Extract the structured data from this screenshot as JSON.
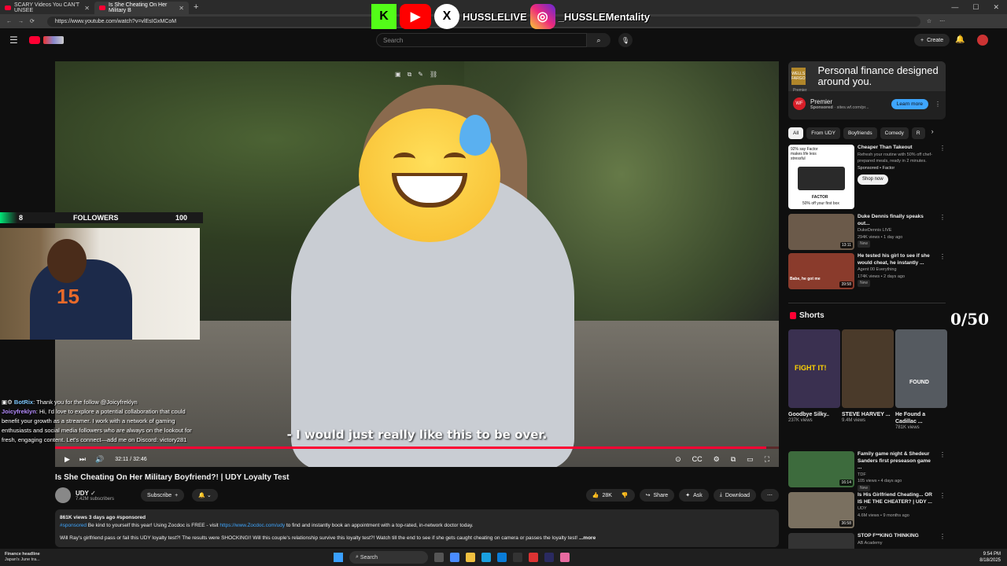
{
  "browser": {
    "tabs": [
      {
        "label": "SCARY Videos You CAN'T UNSEE",
        "active": false
      },
      {
        "label": "Is She Cheating On Her Military B",
        "active": true
      }
    ],
    "url": "https://www.youtube.com/watch?v=vlEsIGxMCoM"
  },
  "overlay": {
    "social_handle_1": "HUSSLELIVE",
    "social_handle_2": "_HUSSLEMentality",
    "followers_count": "8",
    "followers_label": "FOLLOWERS",
    "followers_goal": "100",
    "shorts_counter": "0/50",
    "chat": [
      {
        "user": "BotRix",
        "message": ": Thank you for the follow @Joicyfreklyn"
      },
      {
        "user": "Joicyfreklyn",
        "message": ": Hi, I'd love to explore a potential collaboration that could benefit your growth as a streamer. I work with a network of gaming enthusiasts and social media followers who are always on the lookout for fresh, engaging content. Let's connect—add me on Discord: victory281"
      }
    ]
  },
  "header": {
    "search_placeholder": "Search",
    "create_label": "Create"
  },
  "player": {
    "subtitle": "- I would just really like this to be over.",
    "time": "32:11 / 32:46",
    "progress_fraction": 0.983
  },
  "video": {
    "title": "Is She Cheating On Her Military Boyfriend?! | UDY Loyalty Test",
    "channel": "UDY",
    "subscribers": "7.42M subscribers",
    "subscribe_label": "Subscribe",
    "likes": "28K",
    "share_label": "Share",
    "ask_label": "Ask",
    "download_label": "Download",
    "description": {
      "stats": "861K views  3 days ago  #sponsored",
      "line1_tag": "#sponsored",
      "line1_text": " Be kind to yourself this year! Using Zocdoc is FREE - visit ",
      "line1_link": "https://www.Zocdoc.com/udy",
      "line1_end": " to find and instantly book an appointment with a top-rated, in-network doctor today.",
      "line2": "Will Ray's girlfriend pass or fail this UDY loyalty test?! The results were SHOCKING!! Will this couple's relationship survive this loyalty test?! Watch till the end to see if she gets caught cheating on camera or passes the loyalty test!",
      "more": "...more"
    }
  },
  "sidebar": {
    "ad": {
      "headline": "Personal finance designed around you.",
      "logo_text": "WELLS FARGO",
      "sub_logo": "Premier",
      "circle": "WF",
      "name": "Premier",
      "sponsored": "Sponsored",
      "domain": "sites.wf.com/pr...",
      "cta": "Learn more"
    },
    "chips": [
      "All",
      "From UDY",
      "Boyfriends",
      "Comedy",
      "R"
    ],
    "recommendations": [
      {
        "title": "Cheaper Than Takeout",
        "meta1": "Refresh your routine with 50% off chef-prepared meals, ready in 2 minutes.",
        "meta2": "Sponsored • Factor",
        "cta": "Shop now",
        "thumb_text": "92% say Factor makes life less stressful",
        "thumb_footer": "50% off your first box",
        "thumb_brand": "FACTOR",
        "color": "#ffffff",
        "duration": ""
      },
      {
        "title": "Duke Dennis finally speaks out...",
        "meta1": "DukeDennis LIVE",
        "meta2": "294K views • 1 day ago",
        "new": "New",
        "color": "#6b5a4a",
        "duration": "13:11"
      },
      {
        "title": "He tested his girl to see if she would cheat, he instantly ...",
        "meta1": "Agent 00 Everything",
        "meta2": "174K views • 2 days ago",
        "new": "New",
        "color": "#8a3b2c",
        "duration": "39:58",
        "thumb_text": "Babe, he got me"
      },
      {
        "title": "Family game night & Shedeur Sanders first preseason game ...",
        "meta1": "TDF",
        "meta2": "105 views • 4 days ago",
        "new": "New",
        "color": "#3d6b3d",
        "duration": "16:14"
      },
      {
        "title": "Is His Girlfriend Cheating... OR IS HE THE CHEATER? | UDY ...",
        "meta1": "UDY",
        "meta2": "4.6M views • 9 months ago",
        "new": "",
        "color": "#7a7060",
        "duration": "36:58"
      },
      {
        "title": "STOP F**KING THINKING",
        "meta1": "AB Academy",
        "meta2": "",
        "new": "",
        "color": "#333333",
        "duration": ""
      }
    ],
    "shorts_title": "Shorts",
    "shorts": [
      {
        "title": "Goodbye Silky..",
        "views": "237K views",
        "color": "#3a3050",
        "overlay": "FIGHT IT!"
      },
      {
        "title": "STEVE HARVEY ...",
        "views": "9.4M views",
        "color": "#4a3a2a",
        "overlay": ""
      },
      {
        "title": "He Found a Cadillac ...",
        "views": "781K views",
        "color": "#555a60",
        "overlay": "FOUND"
      }
    ]
  },
  "taskbar": {
    "news_title": "Finance headline",
    "news_sub": "Japan's June tra...",
    "search": "Search",
    "time": "9:54 PM",
    "date": "8/18/2025"
  },
  "icons": {
    "search": "search-icon",
    "mic": "mic-icon",
    "bell": "bell-icon",
    "menu": "hamburger-menu-icon",
    "play": "play-icon",
    "like": "thumbs-up-icon",
    "dislike": "thumbs-down-icon"
  }
}
